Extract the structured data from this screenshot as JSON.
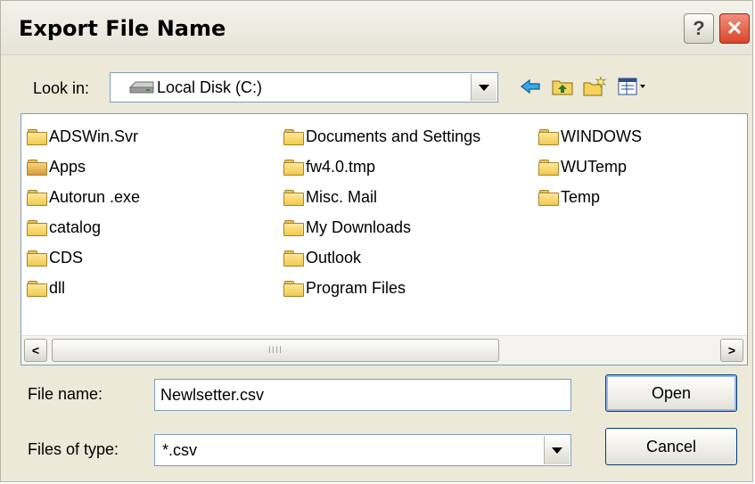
{
  "window": {
    "title": "Export File Name",
    "help_label": "?",
    "close_label": "✕"
  },
  "lookin": {
    "label": "Look in:",
    "value": "Local Disk (C:)",
    "drive_icon": "hard-drive-icon"
  },
  "toolbar": {
    "back_icon": "back-arrow-icon",
    "up_icon": "up-one-level-icon",
    "new_folder_icon": "new-folder-icon",
    "views_icon": "view-menu-icon"
  },
  "files": [
    {
      "name": "ADSWin.Svr"
    },
    {
      "name": "Apps"
    },
    {
      "name": "Autorun .exe"
    },
    {
      "name": "catalog"
    },
    {
      "name": "CDS"
    },
    {
      "name": "dll"
    },
    {
      "name": "Documents and Settings"
    },
    {
      "name": "fw4.0.tmp"
    },
    {
      "name": "Misc. Mail"
    },
    {
      "name": "My Downloads"
    },
    {
      "name": "Outlook"
    },
    {
      "name": "Program Files"
    },
    {
      "name": "WINDOWS"
    },
    {
      "name": "WUTemp"
    },
    {
      "name": "Temp"
    }
  ],
  "scroll": {
    "left": "<",
    "right": ">",
    "grip": "IIII"
  },
  "filename": {
    "label": "File name:",
    "value": "Newlsetter.csv"
  },
  "filetype": {
    "label": "Files of type:",
    "value": "*.csv"
  },
  "buttons": {
    "open": "Open",
    "cancel": "Cancel"
  }
}
